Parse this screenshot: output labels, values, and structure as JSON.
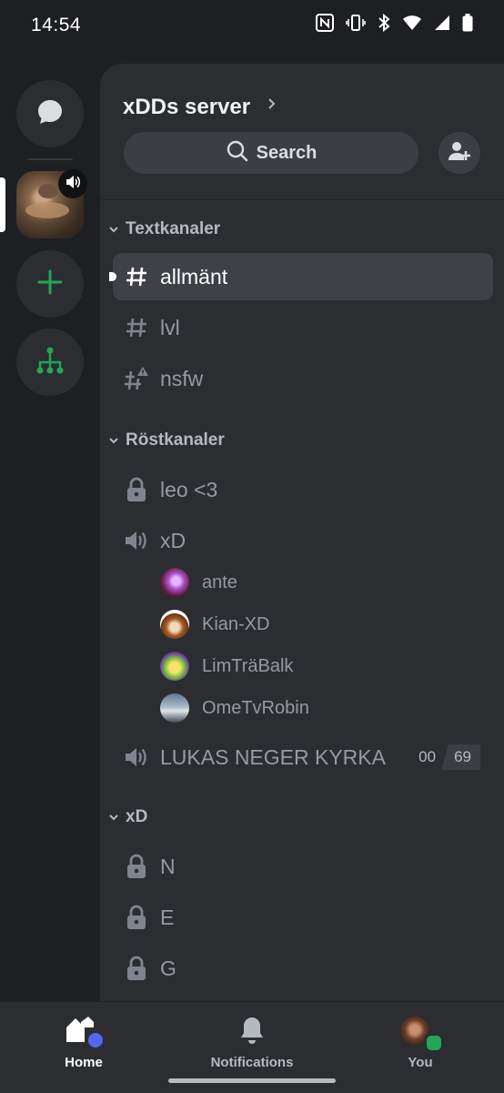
{
  "status_bar": {
    "time": "14:54",
    "icons": [
      "nfc-icon",
      "vibrate-icon",
      "bluetooth-icon",
      "wifi-icon",
      "signal-icon",
      "battery-icon"
    ]
  },
  "rail": {
    "items": [
      {
        "name": "direct-messages",
        "icon": "chat-bubble-icon"
      },
      {
        "name": "xdds-server",
        "icon": "server-avatar",
        "has_voice": true,
        "selected": true
      },
      {
        "name": "add-server",
        "icon": "plus-icon"
      },
      {
        "name": "discover",
        "icon": "hub-icon"
      }
    ]
  },
  "server": {
    "title": "xDDs server",
    "search_label": "Search"
  },
  "categories": [
    {
      "label": "Textkanaler",
      "channels": [
        {
          "name": "allmänt",
          "type": "text",
          "active": true,
          "unread": true
        },
        {
          "name": "lvl",
          "type": "text"
        },
        {
          "name": "nsfw",
          "type": "text-nsfw"
        }
      ]
    },
    {
      "label": "Röstkanaler",
      "channels": [
        {
          "name": "leo <3",
          "type": "locked"
        },
        {
          "name": "xD",
          "type": "voice",
          "members": [
            "ante",
            "Kian-XD",
            "LimTräBalk",
            "OmeTvRobin"
          ]
        },
        {
          "name": "LUKAS NEGER KYRKA",
          "type": "voice",
          "counter_a": "00",
          "counter_b": "69"
        }
      ]
    },
    {
      "label": "xD",
      "channels": [
        {
          "name": "N",
          "type": "locked"
        },
        {
          "name": "E",
          "type": "locked"
        },
        {
          "name": "G",
          "type": "locked"
        }
      ]
    }
  ],
  "colors": {
    "accent": "#5865f2",
    "online": "#23a55a",
    "add_server_green": "#23a55a"
  },
  "bottom_nav": {
    "home": "Home",
    "notifications": "Notifications",
    "you": "You"
  }
}
